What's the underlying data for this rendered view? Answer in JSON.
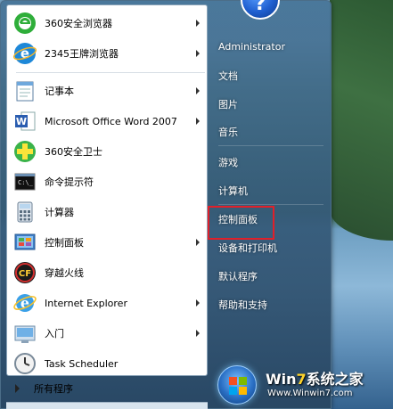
{
  "programs": [
    {
      "label": "360安全浏览器",
      "icon": "360-browser-icon",
      "submenu": true
    },
    {
      "label": "2345王牌浏览器",
      "icon": "2345-browser-icon",
      "submenu": true
    },
    {
      "label": "记事本",
      "icon": "notepad-icon",
      "submenu": true
    },
    {
      "label": "Microsoft Office Word 2007",
      "icon": "word-icon",
      "submenu": true
    },
    {
      "label": "360安全卫士",
      "icon": "360-guard-icon",
      "submenu": false
    },
    {
      "label": "命令提示符",
      "icon": "cmd-icon",
      "submenu": false
    },
    {
      "label": "计算器",
      "icon": "calculator-icon",
      "submenu": false
    },
    {
      "label": "控制面板",
      "icon": "control-panel-icon",
      "submenu": true
    },
    {
      "label": "穿越火线",
      "icon": "crossfire-icon",
      "submenu": false
    },
    {
      "label": "Internet Explorer",
      "icon": "ie-icon",
      "submenu": true
    },
    {
      "label": "入门",
      "icon": "getting-started-icon",
      "submenu": true
    },
    {
      "label": "Task Scheduler",
      "icon": "task-scheduler-icon",
      "submenu": false
    }
  ],
  "all_programs": {
    "label": "所有程序"
  },
  "right_menu": {
    "user": "Administrator",
    "items": [
      "文档",
      "图片",
      "音乐",
      "游戏",
      "计算机",
      "控制面板",
      "设备和打印机",
      "默认程序",
      "帮助和支持"
    ]
  },
  "avatar": {
    "glyph": "?"
  },
  "watermark": {
    "brand_prefix": "Win",
    "brand_digit": "7",
    "brand_suffix": "系统之家",
    "url": "Www.Winwin7.com"
  },
  "colors": {
    "highlight": "#e0202a",
    "menu_bg": "#2f5676",
    "left_pane": "#ffffff"
  }
}
